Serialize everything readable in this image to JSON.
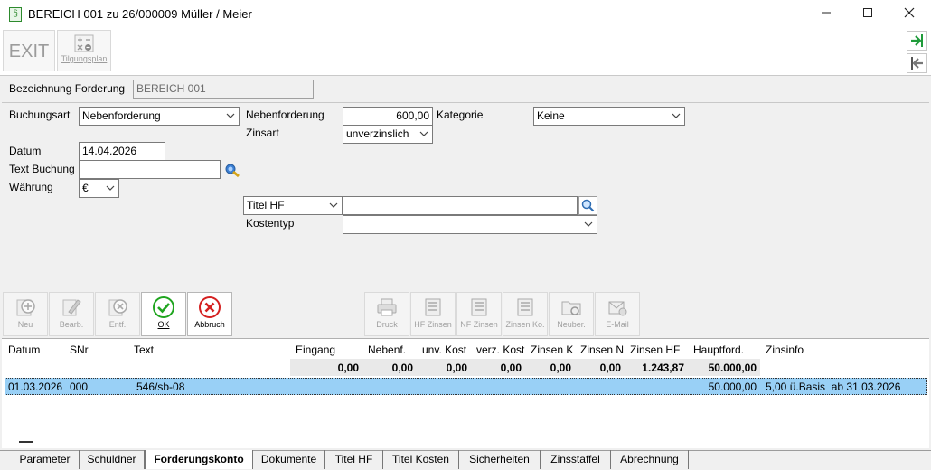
{
  "window": {
    "title": "BEREICH 001 zu 26/000009 Müller / Meier",
    "app_icon_glyph": "§"
  },
  "toolbar": {
    "exit_label": "EXIT",
    "tilgungsplan_label": "Tilgungsplan"
  },
  "form": {
    "bezeichnung_label": "Bezeichnung Forderung",
    "bezeichnung_value": "BEREICH 001",
    "buchungsart_label": "Buchungsart",
    "buchungsart_value": "Nebenforderung",
    "nebenforderung_label": "Nebenforderung",
    "nebenforderung_value": "600,00",
    "kategorie_label": "Kategorie",
    "kategorie_value": "Keine",
    "zinsart_label": "Zinsart",
    "zinsart_value": "unverzinslich",
    "datum_label": "Datum",
    "datum_value": "14.04.2026",
    "text_buchung_label": "Text Buchung",
    "text_buchung_value": "",
    "waehrung_label": "Währung",
    "waehrung_value": "€",
    "titel_hf_value": "Titel HF",
    "titel_search_value": "",
    "kostentyp_label": "Kostentyp",
    "kostentyp_value": ""
  },
  "actions": {
    "neu": "Neu",
    "bearb": "Bearb.",
    "entf": "Entf.",
    "ok": "OK",
    "abbruch": "Abbruch",
    "druck": "Druck",
    "hf_zinsen": "HF Zinsen",
    "nf_zinsen": "NF Zinsen",
    "zinsen_ko": "Zinsen Ko.",
    "neuber": "Neuber.",
    "email": "E-Mail"
  },
  "table": {
    "headers": [
      "Datum",
      "SNr",
      "Text",
      "Eingang",
      "Nebenf.",
      "unv. Kost",
      "verz. Kost",
      "Zinsen K",
      "Zinsen N",
      "Zinsen HF",
      "Hauptford.",
      "Zinsinfo"
    ],
    "totals": [
      "0,00",
      "0,00",
      "0,00",
      "0,00",
      "0,00",
      "0,00",
      "1.243,87",
      "50.000,00"
    ],
    "rows": [
      {
        "datum": "01.03.2026",
        "snr": "000",
        "text": "546/sb-08",
        "hauptford": "50.000,00",
        "zinsinfo": "5,00 ü.Basis  ab 31.03.2026"
      }
    ]
  },
  "tabs": [
    "Parameter",
    "Schuldner",
    "Forderungskonto",
    "Dokumente",
    "Titel HF",
    "Titel Kosten",
    "Sicherheiten",
    "Zinsstaffel",
    "Abrechnung"
  ],
  "colors": {
    "selection": "#99d0f6",
    "ok_green": "#1fa51f",
    "cancel_red": "#d42020",
    "nav_green": "#1f9b3a"
  }
}
